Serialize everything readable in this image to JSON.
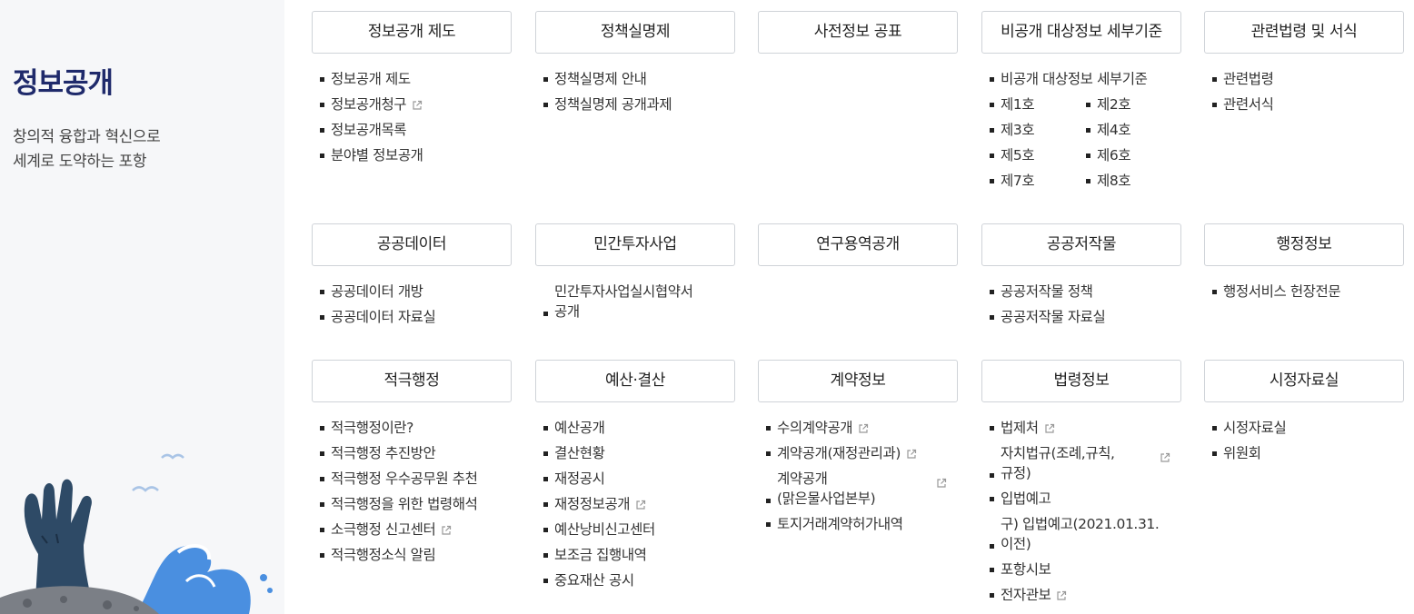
{
  "side": {
    "title": "정보공개",
    "subtitle1": "창의적 융합과 혁신으로",
    "subtitle2": "세계로 도약하는 포항"
  },
  "colors": {
    "title": "#1f2a6b",
    "wave": "#4a8fe0",
    "hand": "#2e4a66"
  },
  "row1": {
    "c1": {
      "title": "정보공개 제도",
      "links": [
        "정보공개 제도",
        "정보공개청구",
        "정보공개목록",
        "분야별 정보공개"
      ]
    },
    "c2": {
      "title": "정책실명제",
      "links": [
        "정책실명제 안내",
        "정책실명제 공개과제"
      ]
    },
    "c3": {
      "title": "사전정보 공표"
    },
    "c4": {
      "title": "비공개 대상정보 세부기준",
      "first": "비공개 대상정보 세부기준",
      "links": [
        "제1호",
        "제2호",
        "제3호",
        "제4호",
        "제5호",
        "제6호",
        "제7호",
        "제8호"
      ]
    },
    "c5": {
      "title": "관련법령 및 서식",
      "links": [
        "관련법령",
        "관련서식"
      ]
    }
  },
  "row2": {
    "c1": {
      "title": "공공데이터",
      "links": [
        "공공데이터 개방",
        "공공데이터 자료실"
      ]
    },
    "c2": {
      "title": "민간투자사업",
      "link1a": "민간투자사업실시협약서",
      "link1b": "공개"
    },
    "c3": {
      "title": "연구용역공개"
    },
    "c4": {
      "title": "공공저작물",
      "links": [
        "공공저작물 정책",
        "공공저작물 자료실"
      ]
    },
    "c5": {
      "title": "행정정보",
      "links": [
        "행정서비스 헌장전문"
      ]
    }
  },
  "row3": {
    "c1": {
      "title": "적극행정",
      "links": [
        "적극행정이란?",
        "적극행정 추진방안",
        "적극행정 우수공무원 추천",
        "적극행정을 위한 법령해석",
        "소극행정 신고센터",
        "적극행정소식 알림"
      ]
    },
    "c2": {
      "title": "예산·결산",
      "links": [
        "예산공개",
        "결산현황",
        "재정공시",
        "재정정보공개",
        "예산낭비신고센터",
        "보조금 집행내역",
        "중요재산 공시"
      ]
    },
    "c3": {
      "title": "계약정보",
      "links": [
        "수의계약공개",
        "계약공개(재정관리과)"
      ],
      "link3a": "계약공개",
      "link3b": "(맑은물사업본부)",
      "link4": "토지거래계약허가내역"
    },
    "c4": {
      "title": "법령정보",
      "link1": "법제처",
      "link2a": "자치법규(조례,규칙,",
      "link2b": "규정)",
      "link3": "입법예고",
      "link4a": "구) 입법예고(2021.01.31.",
      "link4b": "이전)",
      "link5": "포항시보",
      "link6": "전자관보"
    },
    "c5": {
      "title": "시정자료실",
      "links": [
        "시정자료실",
        "위원회"
      ]
    }
  }
}
